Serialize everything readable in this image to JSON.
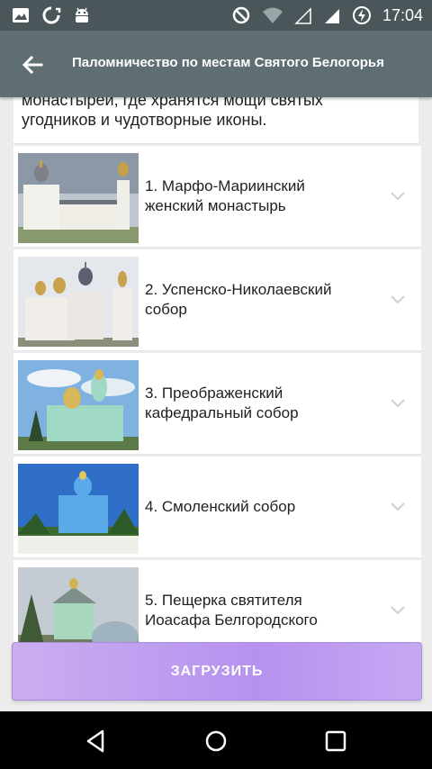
{
  "status_bar": {
    "time": "17:04",
    "left_icons": [
      "image-icon",
      "sync-icon",
      "android-icon"
    ],
    "right_icons": [
      "do-not-disturb-icon",
      "wifi-icon",
      "signal-icon",
      "signal-icon",
      "battery-charging-icon"
    ]
  },
  "app_bar": {
    "title": "Паломничество по местам Святого Белогорья",
    "back_icon": "arrow-back-icon"
  },
  "intro": {
    "line1": "монастырей, где хранятся мощи святых",
    "line2": "угодников и чудотворные иконы."
  },
  "items": [
    {
      "line1": "1. Марфо-Мариинский",
      "line2": "женский монастырь",
      "thumb": "monastery-photo"
    },
    {
      "line1": "2. Успенско-Николаевский",
      "line2": "собор",
      "thumb": "cathedral-photo"
    },
    {
      "line1": "3. Преображенский",
      "line2": "кафедральный собор",
      "thumb": "cathedral-photo"
    },
    {
      "line1": "4. Смоленский собор",
      "line2": "",
      "thumb": "cathedral-photo"
    },
    {
      "line1": "5. Пещерка святителя",
      "line2": "Иоасафа Белгородского",
      "thumb": "chapel-photo"
    }
  ],
  "load_button": {
    "label": "ЗАГРУЗИТЬ"
  },
  "colors": {
    "app_bar": "#5f6e72",
    "status_bar": "#4a5659",
    "button": "#b592f0"
  }
}
